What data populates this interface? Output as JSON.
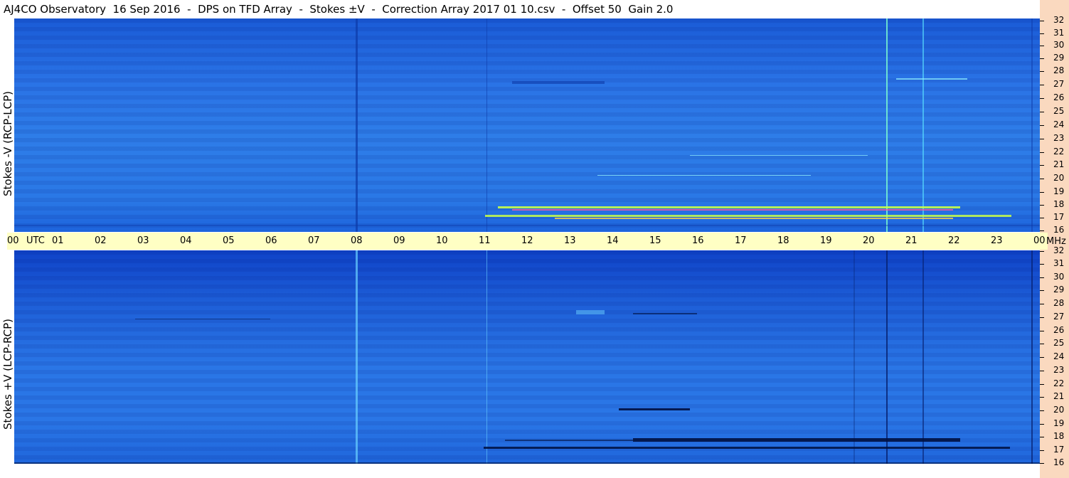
{
  "title": "AJ4CO Observatory  16 Sep 2016  -  DPS on TFD Array  -  Stokes ±V  -  Correction Array 2017 01 10.csv  -  Offset 50  Gain 2.0",
  "top_panel": {
    "ylabel": "Stokes -V (RCP-LCP)"
  },
  "bottom_panel": {
    "ylabel": "Stokes +V (LCP-RCP)"
  },
  "time_axis": {
    "utc_label": "UTC",
    "hours": [
      "00",
      "01",
      "02",
      "03",
      "04",
      "05",
      "06",
      "07",
      "08",
      "09",
      "10",
      "11",
      "12",
      "13",
      "14",
      "15",
      "16",
      "17",
      "18",
      "19",
      "20",
      "21",
      "22",
      "23",
      "00"
    ]
  },
  "freq_axis": {
    "unit": "MHz",
    "top_ticks": [
      "32",
      "31",
      "30",
      "29",
      "28",
      "27",
      "26",
      "25",
      "24",
      "23",
      "22",
      "21",
      "20",
      "19",
      "18",
      "17",
      "16"
    ],
    "bottom_ticks": [
      "32",
      "31",
      "30",
      "29",
      "28",
      "27",
      "26",
      "25",
      "24",
      "23",
      "22",
      "21",
      "20",
      "19",
      "18",
      "17",
      "16"
    ]
  },
  "colors": {
    "background_blue": "#2a76e6",
    "time_bar": "#ffffc4",
    "right_strip": "#fad9bf"
  }
}
